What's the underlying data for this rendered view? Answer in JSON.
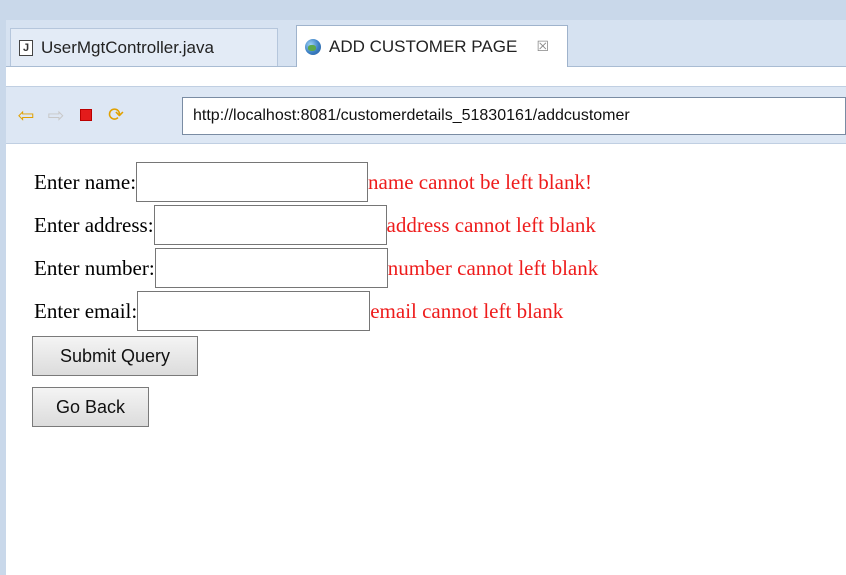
{
  "tabs": [
    {
      "label": "UserMgtController.java",
      "icon": "java-file-icon"
    },
    {
      "label": "ADD CUSTOMER PAGE",
      "icon": "globe-icon",
      "close": "☒"
    }
  ],
  "browser": {
    "url": "http://localhost:8081/customerdetails_51830161/addcustomer"
  },
  "form": {
    "name_label": "Enter name:",
    "name_value": "",
    "name_error": "name cannot be left blank!",
    "address_label": "Enter address:",
    "address_value": "",
    "address_error": "address cannot left blank",
    "number_label": "Enter number:",
    "number_value": "",
    "number_error": "number cannot left blank",
    "email_label": "Enter email:",
    "email_value": "",
    "email_error": "email cannot left blank",
    "submit_label": "Submit Query",
    "back_label": "Go Back"
  },
  "colors": {
    "error": "#ee1c1c",
    "tabbar": "#d6e2f1"
  }
}
